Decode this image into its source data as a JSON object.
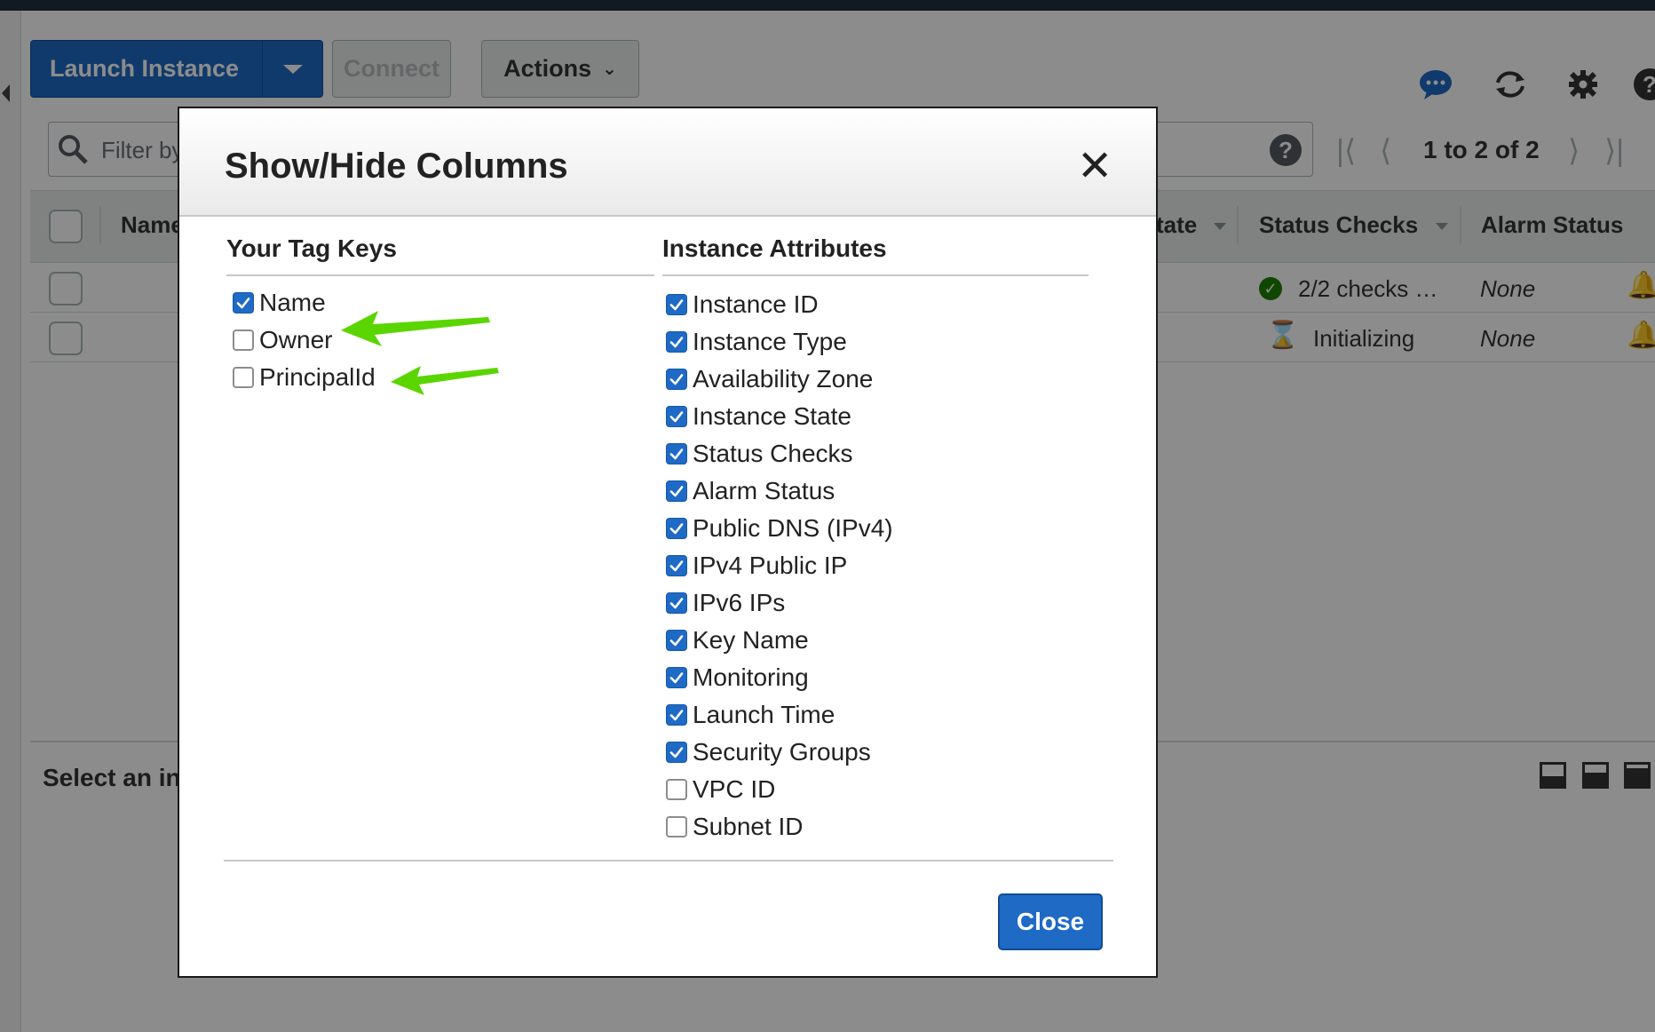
{
  "toolbar": {
    "launch_label": "Launch Instance",
    "connect_label": "Connect",
    "actions_label": "Actions"
  },
  "filter": {
    "placeholder": "Filter by"
  },
  "pagination": {
    "label": "1 to 2 of 2"
  },
  "table": {
    "headers": {
      "name": "Name",
      "state": "tate",
      "status_checks": "Status Checks",
      "alarm_status": "Alarm Status"
    },
    "rows": [
      {
        "status_checks": "2/2 checks …",
        "alarm_status": "None"
      },
      {
        "status_checks": "Initializing",
        "alarm_status": "None"
      }
    ]
  },
  "detail": {
    "select_text": "Select an in"
  },
  "modal": {
    "title": "Show/Hide Columns",
    "close_x": "✕",
    "close_button": "Close",
    "tag_keys": {
      "heading": "Your Tag Keys",
      "items": [
        {
          "label": "Name",
          "checked": true
        },
        {
          "label": "Owner",
          "checked": false
        },
        {
          "label": "PrincipalId",
          "checked": false
        }
      ]
    },
    "attributes": {
      "heading": "Instance Attributes",
      "items": [
        {
          "label": "Instance ID",
          "checked": true
        },
        {
          "label": "Instance Type",
          "checked": true
        },
        {
          "label": "Availability Zone",
          "checked": true
        },
        {
          "label": "Instance State",
          "checked": true
        },
        {
          "label": "Status Checks",
          "checked": true
        },
        {
          "label": "Alarm Status",
          "checked": true
        },
        {
          "label": "Public DNS (IPv4)",
          "checked": true
        },
        {
          "label": "IPv4 Public IP",
          "checked": true
        },
        {
          "label": "IPv6 IPs",
          "checked": true
        },
        {
          "label": "Key Name",
          "checked": true
        },
        {
          "label": "Monitoring",
          "checked": true
        },
        {
          "label": "Launch Time",
          "checked": true
        },
        {
          "label": "Security Groups",
          "checked": true
        },
        {
          "label": "VPC ID",
          "checked": false
        },
        {
          "label": "Subnet ID",
          "checked": false
        }
      ]
    }
  },
  "icons": {
    "chat": "chat-bubble-icon",
    "refresh": "refresh-icon",
    "settings": "gear-icon",
    "help": "help-icon"
  },
  "colors": {
    "primary": "#1e6ac5",
    "annotation_arrow": "#5ad500",
    "ok": "#1d8102"
  }
}
